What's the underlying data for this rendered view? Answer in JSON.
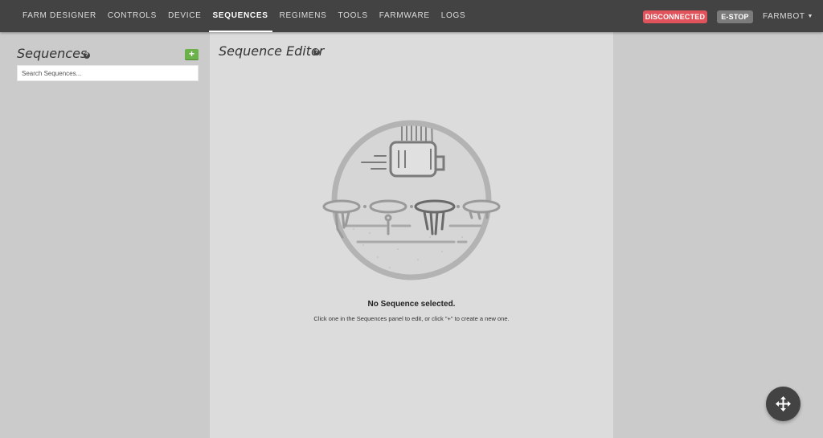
{
  "nav": {
    "links": [
      {
        "label": "FARM DESIGNER",
        "active": false
      },
      {
        "label": "CONTROLS",
        "active": false
      },
      {
        "label": "DEVICE",
        "active": false
      },
      {
        "label": "SEQUENCES",
        "active": true
      },
      {
        "label": "REGIMENS",
        "active": false
      },
      {
        "label": "TOOLS",
        "active": false
      },
      {
        "label": "FARMWARE",
        "active": false
      },
      {
        "label": "LOGS",
        "active": false
      }
    ],
    "status_badge": "DISCONNECTED",
    "estop_label": "E-STOP",
    "account_label": "FARMBOT",
    "account_icon": "chevron-down-icon"
  },
  "sequences_panel": {
    "title": "Sequences",
    "help_icon": "question-circle-icon",
    "add_label": "+",
    "search_placeholder": "Search Sequences..."
  },
  "editor_panel": {
    "title": "Sequence Editor",
    "help_icon": "question-circle-icon",
    "empty_title": "No Sequence selected.",
    "empty_subtitle": "Click one in the Sequences panel to edit, or click \"+\" to create a new one."
  },
  "fab": {
    "icon": "move-arrows-icon"
  },
  "colors": {
    "nav_bg": "#434343",
    "disconnected": "#e0535b",
    "estop": "#7b7b7b",
    "add_button": "#6bb24b",
    "panel_bg": "#cbcbcb",
    "editor_bg": "#dcdcdc"
  }
}
